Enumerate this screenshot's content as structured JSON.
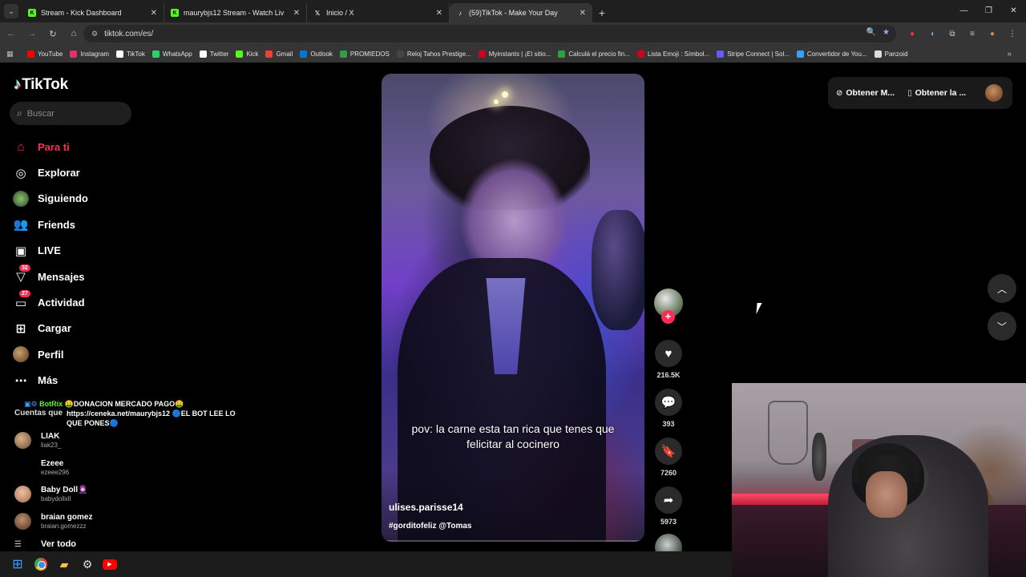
{
  "browser": {
    "tabs": [
      {
        "title": "Stream - Kick Dashboard",
        "favicon": "kick-icon"
      },
      {
        "title": "maurybjs12 Stream - Watch Liv",
        "favicon": "kick-icon"
      },
      {
        "title": "Inicio / X",
        "favicon": "x-icon"
      },
      {
        "title": "(59)TikTok - Make Your Day",
        "favicon": "tiktok-icon",
        "active": true
      }
    ],
    "url": "tiktok.com/es/",
    "bookmarks": [
      {
        "label": "YouTube",
        "color": "#ff0000"
      },
      {
        "label": "Instagram",
        "color": "#e1306c"
      },
      {
        "label": "TikTok",
        "color": "#ffffff"
      },
      {
        "label": "WhatsApp",
        "color": "#25d366"
      },
      {
        "label": "Twitter",
        "color": "#ffffff"
      },
      {
        "label": "Kick",
        "color": "#53fc18"
      },
      {
        "label": "Gmail",
        "color": "#ea4335"
      },
      {
        "label": "Outlook",
        "color": "#0078d4"
      },
      {
        "label": "PROMIEDOS",
        "color": "#2ea043"
      },
      {
        "label": "Reloj Tahos Prestige...",
        "color": "#444444"
      },
      {
        "label": "Myinstants | ¡El sitio...",
        "color": "#d0021b"
      },
      {
        "label": "Calculá el precio fin...",
        "color": "#2ea043"
      },
      {
        "label": "Lista Emoji : Símbol...",
        "color": "#d0021b"
      },
      {
        "label": "Stripe Connect | Sol...",
        "color": "#635bff"
      },
      {
        "label": "Convertidor de You...",
        "color": "#3aa0ff"
      },
      {
        "label": "Panzoid",
        "color": "#dddddd"
      }
    ]
  },
  "tiktok": {
    "logo": "TikTok",
    "search_placeholder": "Buscar",
    "nav": [
      {
        "label": "Para ti",
        "icon": "home-icon",
        "active": true
      },
      {
        "label": "Explorar",
        "icon": "compass-icon"
      },
      {
        "label": "Siguiendo",
        "icon": "following-avatar"
      },
      {
        "label": "Friends",
        "icon": "friends-icon"
      },
      {
        "label": "LIVE",
        "icon": "live-icon"
      },
      {
        "label": "Mensajes",
        "icon": "messages-icon",
        "badge": "32"
      },
      {
        "label": "Actividad",
        "icon": "activity-icon",
        "badge": "27"
      },
      {
        "label": "Cargar",
        "icon": "upload-icon"
      },
      {
        "label": "Perfil",
        "icon": "profile-avatar"
      },
      {
        "label": "Más",
        "icon": "more-icon"
      }
    ],
    "following_heading": "Cuentas que",
    "following": [
      {
        "name": "LIAK",
        "username": "liak23_"
      },
      {
        "name": "Ezeee",
        "username": "ezeee296"
      },
      {
        "name": "Baby Doll🧕🏻",
        "username": "babydollxll"
      },
      {
        "name": "braian gomez",
        "username": "braian.gomezzz"
      }
    ],
    "see_all": "Ver todo",
    "video": {
      "caption": "pov: la carne esta tan rica que tenes que felicitar al cocinero",
      "username": "ulises.parisse14",
      "tags": "#gorditofeliz @Tomas",
      "likes": "216.5K",
      "comments": "393",
      "saves": "7260",
      "shares": "5973"
    },
    "top_right": {
      "get_coins": "Obtener M...",
      "get_app": "Obtener la ..."
    }
  },
  "stream_overlay": {
    "bot": "BotRix",
    "message_1": "🤑DONACION MERCADO PAGO🤑",
    "message_2": "https://ceneka.net/maurybjs12 🔵EL BOT LEE LO QUE PONES🔵"
  }
}
